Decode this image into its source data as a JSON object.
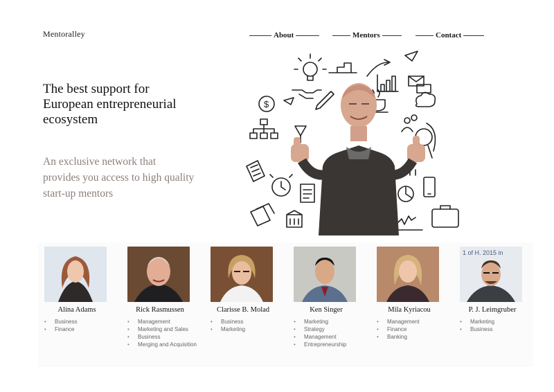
{
  "site": {
    "logo": "Mentoralley"
  },
  "nav": [
    {
      "label": "About"
    },
    {
      "label": "Mentors"
    },
    {
      "label": "Contact"
    }
  ],
  "hero": {
    "title": "The best support for European entrepreneurial ecosystem",
    "subtitle": "An exclusive network that provides you access to high quality start-up mentors"
  },
  "mentors": [
    {
      "name": "Alina Adams",
      "tags": [
        "Business",
        "Finance"
      ]
    },
    {
      "name": "Rick Rasmussen",
      "tags": [
        "Management",
        "Marketing and Sales",
        "Business",
        "Merging and Acquisition"
      ]
    },
    {
      "name": "Clarisse B. Molad",
      "tags": [
        "Business",
        "Marketing"
      ]
    },
    {
      "name": "Ken Singer",
      "tags": [
        "Marketing",
        "Strategy",
        "Management",
        "Entrepreneurship"
      ]
    },
    {
      "name": "Mila Kyriacou",
      "tags": [
        "Management",
        "Finance",
        "Banking"
      ]
    },
    {
      "name": "P. J. Leimgruber",
      "tags": [
        "Marketing",
        "Business"
      ]
    }
  ],
  "photo_banner_text": "1 of H. 2015 in",
  "colors": {
    "subtitle": "#8a7f7a",
    "text": "#111111",
    "tag": "#666666"
  }
}
